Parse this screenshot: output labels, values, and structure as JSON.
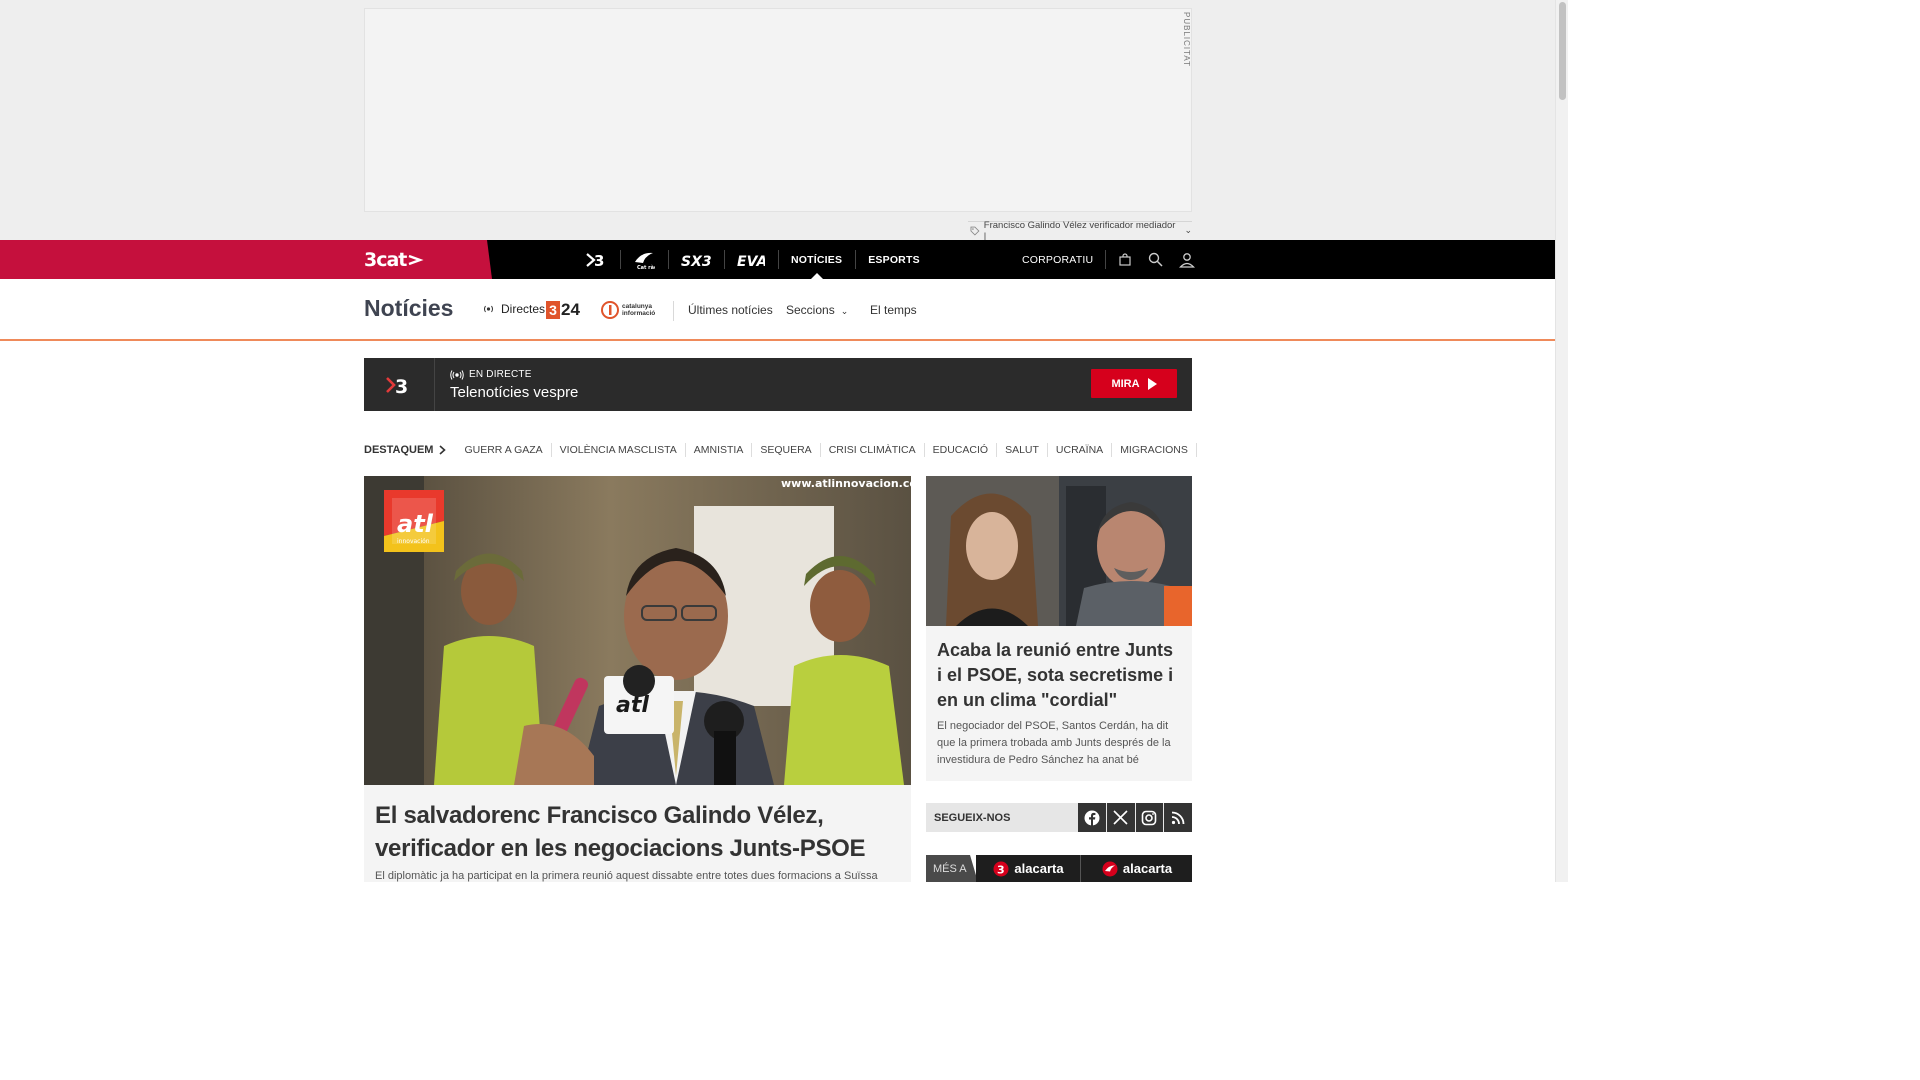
{
  "ad": {
    "label": "PUBLICITAT",
    "topic_text": "Francisco Galindo Vélez verificador mediador |"
  },
  "topnav": {
    "brand": "3cat",
    "channels": [
      {
        "label": "3",
        "icon": "tv3-logo-icon"
      },
      {
        "label": "Cat ràdio",
        "icon": "catradio-logo-icon"
      },
      {
        "label": "SX3",
        "icon": "sx3-logo-icon"
      },
      {
        "label": "EVA",
        "icon": "eva-logo-icon"
      },
      {
        "label": "NOTÍCIES"
      },
      {
        "label": "ESPORTS"
      }
    ],
    "corporatiu": "CORPORATIU"
  },
  "section": {
    "title": "Notícies",
    "directes": "Directes",
    "logo_324": "24",
    "logo_324_prefix": "3",
    "logo_ci": "catalunya informació",
    "links": [
      "Últimes notícies",
      "Seccions",
      "El temps"
    ]
  },
  "live": {
    "logo": "3",
    "kicker": "EN DIRECTE",
    "title": "Telenotícies vespre",
    "button": "MIRA"
  },
  "destaquem": {
    "label": "DESTAQUEM",
    "items": [
      "GUERR A GAZA",
      "VIOLÈNCIA MASCLISTA",
      "AMNISTIA",
      "SEQUERA",
      "CRISI CLIMÀTICA",
      "EDUCACIÓ",
      "SALUT",
      "UCRAÏNA",
      "MIGRACIONS"
    ]
  },
  "main_article": {
    "watermark": "www.atlinnovacion.com",
    "badge": "atl",
    "badge_sub": "innovación",
    "title": "El salvadorenc Francisco Galindo Vélez, verificador en les negociacions Junts-PSOE",
    "lead": "El diplomàtic ja ha participat en la primera reunió aquest dissabte entre totes dues formacions a Suïssa"
  },
  "side_article": {
    "title": "Acaba la reunió entre Junts i el PSOE, sota secretisme i en un clima \"cordial\"",
    "lead": "El negociador del PSOE, Santos Cerdán, ha dit que la primera trobada amb Junts després de la investidura de Pedro Sánchez ha anat bé"
  },
  "follow": {
    "label": "SEGUEIX-NOS",
    "networks": [
      "facebook-icon",
      "x-icon",
      "instagram-icon",
      "rss-icon"
    ]
  },
  "mesa": {
    "label": "MÉS A",
    "buttons": [
      {
        "prefix": "3",
        "text": "alacarta"
      },
      {
        "prefix": "",
        "text": "alacarta"
      }
    ]
  },
  "colors": {
    "brand_red": "#c5103d",
    "live_red": "#d6001c",
    "section_accent": "#ef8a5a",
    "nav_bg": "#000000"
  }
}
